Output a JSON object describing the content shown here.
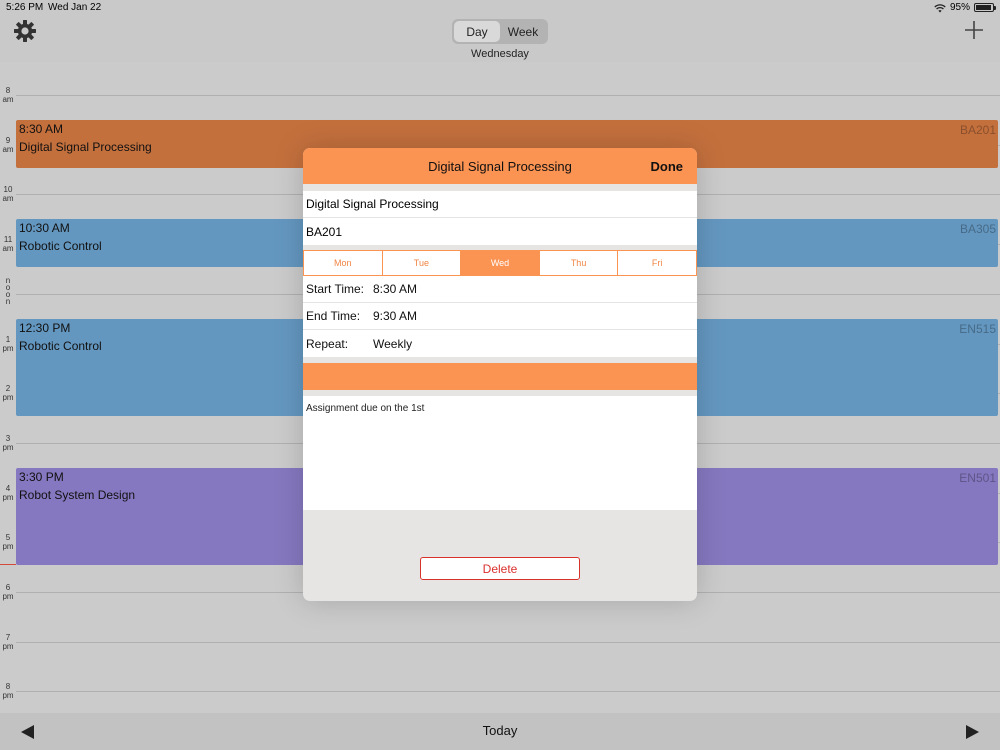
{
  "status": {
    "time": "5:26 PM",
    "date": "Wed Jan 22",
    "battery": "95%",
    "battery_level": 0.95
  },
  "header": {
    "tabs": {
      "day": "Day",
      "week": "Week"
    },
    "active_tab": "day",
    "day_title": "Wednesday"
  },
  "calendar": {
    "hours": [
      {
        "num": "8",
        "suffix": "am"
      },
      {
        "num": "9",
        "suffix": "am"
      },
      {
        "num": "10",
        "suffix": "am"
      },
      {
        "num": "11",
        "suffix": "am"
      },
      {
        "num": "noon",
        "suffix": ""
      },
      {
        "num": "1",
        "suffix": "pm"
      },
      {
        "num": "2",
        "suffix": "pm"
      },
      {
        "num": "3",
        "suffix": "pm"
      },
      {
        "num": "4",
        "suffix": "pm"
      },
      {
        "num": "5",
        "suffix": "pm"
      },
      {
        "num": "6",
        "suffix": "pm"
      },
      {
        "num": "7",
        "suffix": "pm"
      },
      {
        "num": "8",
        "suffix": "pm"
      }
    ],
    "events": [
      {
        "time": "8:30 AM",
        "title": "Digital Signal Processing",
        "room": "BA201",
        "color": "#c4703d"
      },
      {
        "time": "10:30 AM",
        "title": "Robotic Control",
        "room": "BA305",
        "color": "#6497c0"
      },
      {
        "time": "12:30 PM",
        "title": "Robotic Control",
        "room": "EN515",
        "color": "#6497c0"
      },
      {
        "time": "3:30 PM",
        "title": "Robot System Design",
        "room": "EN501",
        "color": "#8678c0"
      }
    ]
  },
  "toolbar": {
    "today_label": "Today"
  },
  "modal": {
    "title": "Digital Signal Processing",
    "done_label": "Done",
    "course_name": "Digital Signal Processing",
    "room": "BA201",
    "days": [
      "Mon",
      "Tue",
      "Wed",
      "Thu",
      "Fri"
    ],
    "selected_day": "Wed",
    "start_label": "Start Time:",
    "start_value": "8:30 AM",
    "end_label": "End Time:",
    "end_value": "9:30 AM",
    "repeat_label": "Repeat:",
    "repeat_value": "Weekly",
    "notes": "Assignment due on the 1st",
    "delete_label": "Delete",
    "accent_color": "#fb9352"
  }
}
